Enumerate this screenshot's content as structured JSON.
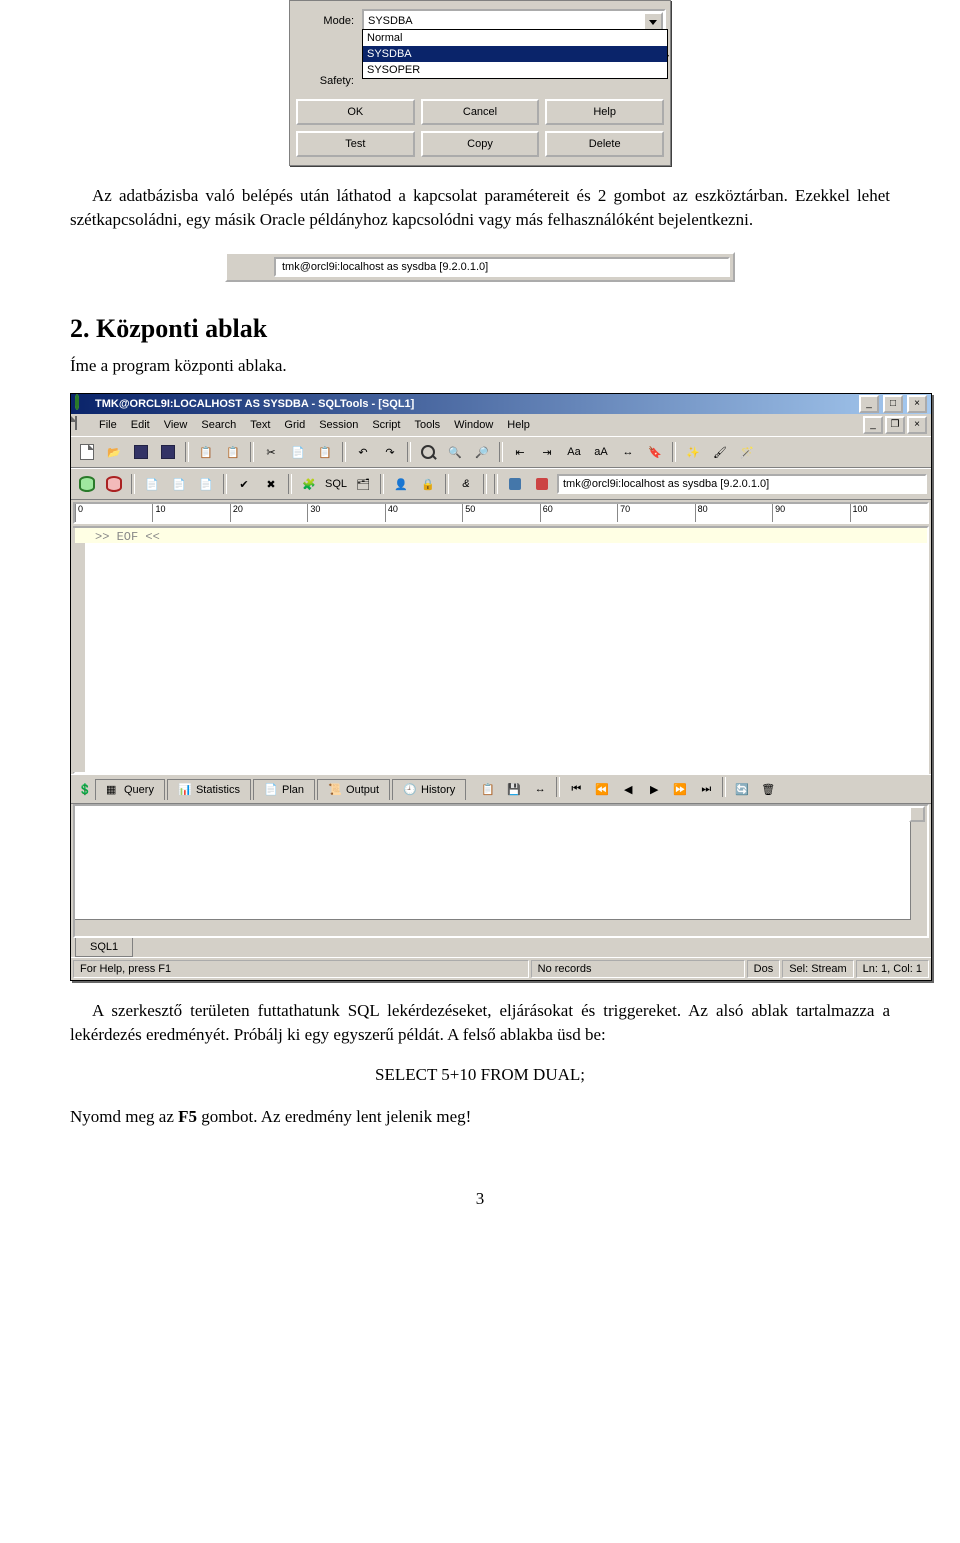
{
  "dialog": {
    "mode_label": "Mode:",
    "mode_value": "SYSDBA",
    "safety_label": "Safety:",
    "dropdown": {
      "options": [
        "Normal",
        "SYSDBA",
        "SYSOPER"
      ],
      "selected": "SYSDBA"
    },
    "buttons_row1": {
      "ok": "OK",
      "cancel": "Cancel",
      "help": "Help"
    },
    "buttons_row2": {
      "test": "Test",
      "copy": "Copy",
      "delete": "Delete"
    }
  },
  "body": {
    "p1": "Az adatbázisba való belépés után láthatod a kapcsolat paramétereit és 2 gombot az eszköztárban. Ezekkel lehet szétkapcsoládni, egy másik Oracle példányhoz kapcsolódni vagy más felhasználóként bejelentkezni.",
    "heading": "2.    Központi ablak",
    "p2": "Íme a program központi ablaka.",
    "p3a": "A szerkesztő területen futtathatunk SQL lekérdezéseket, eljárásokat és triggereket.  Az alsó ablak tartalmazza a lekérdezés eredményét.  Próbálj ki egy egyszerű példát.  A felső ablakba üsd be:",
    "sqlline": "SELECT 5+10 FROM DUAL;",
    "p4a": "Nyomd meg az ",
    "p4b": "F5",
    "p4c": " gombot. Az eredmény lent jelenik meg!",
    "pagenum": "3"
  },
  "strip": {
    "text": "tmk@orcl9i:localhost as sysdba [9.2.0.1.0]"
  },
  "ide": {
    "title": "TMK@ORCL9I:LOCALHOST AS SYSDBA - SQLTools - [SQL1]",
    "menu": [
      "File",
      "Edit",
      "View",
      "Search",
      "Text",
      "Grid",
      "Session",
      "Script",
      "Tools",
      "Window",
      "Help"
    ],
    "ruler": [
      "0",
      "10",
      "20",
      "30",
      "40",
      "50",
      "60",
      "70",
      "80",
      "90",
      "100"
    ],
    "editor_eof": ">> EOF <<",
    "conn_text": "tmk@orcl9i:localhost as sysdba [9.2.0.1.0]",
    "tabs": [
      "Query",
      "Statistics",
      "Plan",
      "Output",
      "History"
    ],
    "bottom_tab": "SQL1",
    "status": {
      "help": "For Help, press F1",
      "rec": "No records",
      "dos": "Dos",
      "sel": "Sel: Stream",
      "pos": "Ln: 1, Col: 1"
    }
  }
}
